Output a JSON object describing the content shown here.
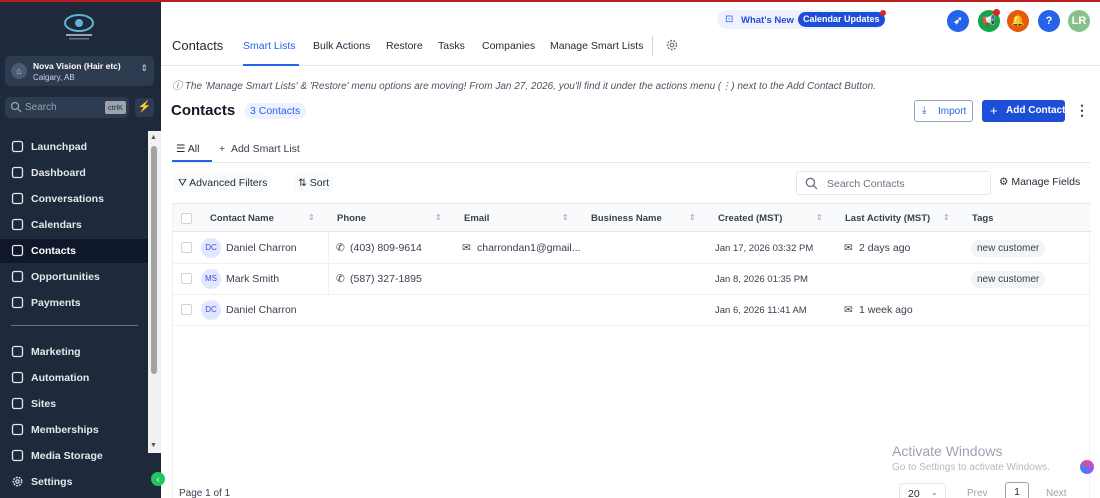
{
  "sidebar": {
    "logo_icon": "eye-logo-icon",
    "account_name": "Nova Vision (Hair etc)",
    "account_location": "Calgary, AB",
    "search_placeholder": "Search",
    "search_shortcut": "ctrlK",
    "nav_top": [
      {
        "label": "Launchpad",
        "icon": "rocket-icon"
      },
      {
        "label": "Dashboard",
        "icon": "dashboard-icon"
      },
      {
        "label": "Conversations",
        "icon": "chat-icon"
      },
      {
        "label": "Calendars",
        "icon": "calendar-icon"
      },
      {
        "label": "Contacts",
        "icon": "contacts-icon",
        "active": true
      },
      {
        "label": "Opportunities",
        "icon": "opportunities-icon"
      },
      {
        "label": "Payments",
        "icon": "payments-icon"
      }
    ],
    "nav_bottom": [
      {
        "label": "Marketing",
        "icon": "send-icon"
      },
      {
        "label": "Automation",
        "icon": "automation-icon"
      },
      {
        "label": "Sites",
        "icon": "sites-icon"
      },
      {
        "label": "Memberships",
        "icon": "memberships-icon"
      },
      {
        "label": "Media Storage",
        "icon": "media-icon"
      }
    ],
    "settings_label": "Settings"
  },
  "header": {
    "whats_new_label": "What's New",
    "calendar_updates_label": "Calendar Updates",
    "user_initials": "LR",
    "help_label": "?"
  },
  "tabs": {
    "title": "Contacts",
    "items": [
      "Smart Lists",
      "Bulk Actions",
      "Restore",
      "Tasks",
      "Companies",
      "Manage Smart Lists"
    ],
    "active": "Smart Lists"
  },
  "notice": "The 'Manage Smart Lists' & 'Restore' menu options are moving! From Jan 27, 2026, you'll find it under the actions menu (⋮) next to the Add Contact Button.",
  "page": {
    "title": "Contacts",
    "count_label": "3 Contacts",
    "import_label": "Import",
    "add_contact_label": "Add Contact"
  },
  "subtabs": {
    "all_label": "All",
    "add_smart_list_label": "Add Smart List"
  },
  "toolbar": {
    "advanced_filters_label": "Advanced Filters",
    "sort_label": "Sort",
    "search_placeholder": "Search Contacts",
    "manage_fields_label": "Manage Fields"
  },
  "table": {
    "columns": [
      "Contact Name",
      "Phone",
      "Email",
      "Business Name",
      "Created (MST)",
      "Last Activity (MST)",
      "Tags"
    ],
    "rows": [
      {
        "initials": "DC",
        "name": "Daniel Charron",
        "phone": "(403) 809-9614",
        "email": "charrondan1@gmail...",
        "business": "",
        "created": "Jan 17, 2026 03:32 PM",
        "last_activity": "2 days ago",
        "tag": "new customer"
      },
      {
        "initials": "MS",
        "name": "Mark Smith",
        "phone": "(587) 327-1895",
        "email": "",
        "business": "",
        "created": "Jan 8, 2026 01:35 PM",
        "last_activity": "",
        "tag": "new customer"
      },
      {
        "initials": "DC",
        "name": "Daniel Charron",
        "phone": "",
        "email": "",
        "business": "",
        "created": "Jan 6, 2026 11:41 AM",
        "last_activity": "1 week ago",
        "tag": ""
      }
    ]
  },
  "footer": {
    "page_label": "Page 1 of 1",
    "per_page": "20",
    "prev_label": "Prev",
    "current_page": "1",
    "next_label": "Next"
  },
  "watermark": {
    "line1": "Activate Windows",
    "line2": "Go to Settings to activate Windows."
  },
  "colors": {
    "primary": "#1d4ed8",
    "sidebar_bg": "#1e2a3b",
    "accent_green": "#22c55e"
  }
}
